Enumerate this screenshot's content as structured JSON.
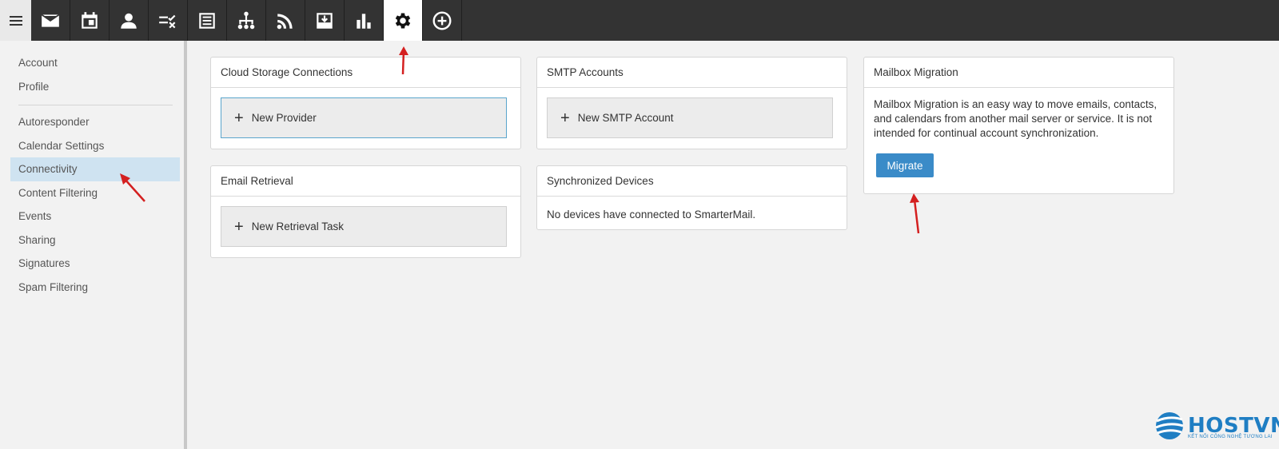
{
  "toolbar": {
    "items": [
      {
        "icon": "mail-icon"
      },
      {
        "icon": "calendar-icon"
      },
      {
        "icon": "contacts-icon"
      },
      {
        "icon": "tasks-icon"
      },
      {
        "icon": "notes-icon"
      },
      {
        "icon": "file-tree-icon"
      },
      {
        "icon": "rss-icon"
      },
      {
        "icon": "inbox-download-icon"
      },
      {
        "icon": "reports-chart-icon"
      },
      {
        "icon": "settings-gear-icon",
        "active": true
      },
      {
        "icon": "add-circle-icon"
      }
    ]
  },
  "sidebar": {
    "items": [
      {
        "label": "Account"
      },
      {
        "label": "Profile"
      },
      {
        "label": "Autoresponder"
      },
      {
        "label": "Calendar Settings"
      },
      {
        "label": "Connectivity",
        "active": true
      },
      {
        "label": "Content Filtering"
      },
      {
        "label": "Events"
      },
      {
        "label": "Sharing"
      },
      {
        "label": "Signatures"
      },
      {
        "label": "Spam Filtering"
      }
    ]
  },
  "cards": {
    "cloud": {
      "title": "Cloud Storage Connections",
      "button": "New Provider"
    },
    "email_retrieval": {
      "title": "Email Retrieval",
      "button": "New Retrieval Task"
    },
    "smtp": {
      "title": "SMTP Accounts",
      "button": "New SMTP Account"
    },
    "devices": {
      "title": "Synchronized Devices",
      "text": "No devices have connected to SmarterMail."
    },
    "migration": {
      "title": "Mailbox Migration",
      "text": "Mailbox Migration is an easy way to move emails, contacts, and calendars from another mail server or service. It is not intended for continual account synchronization.",
      "button": "Migrate"
    }
  },
  "watermark": {
    "brand": "HOSTVN",
    "tagline": "KẾT NỐI CÔNG NGHỆ TƯƠNG LAI"
  },
  "colors": {
    "toolbar": "#333333",
    "accent": "#3a8bc8",
    "active_sidebar": "#cfe3f1",
    "annotation_arrow": "#d42020"
  }
}
